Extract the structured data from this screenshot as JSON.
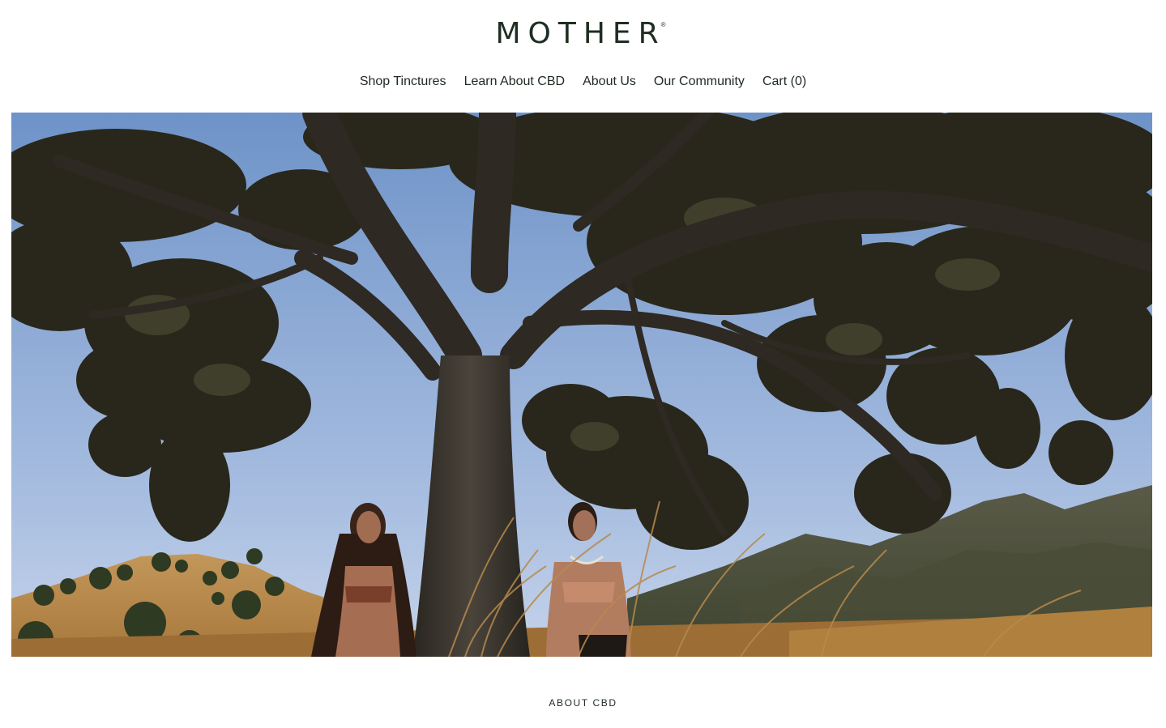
{
  "header": {
    "logo_text": "MOTHER",
    "logo_mark": "®"
  },
  "nav": {
    "items": [
      {
        "label": "Shop Tinctures"
      },
      {
        "label": "Learn About CBD"
      },
      {
        "label": "About Us"
      },
      {
        "label": "Our Community"
      },
      {
        "label": "Cart (0)"
      }
    ]
  },
  "hero": {
    "image": "photo of two women walking in dry grass beneath a large oak tree with hills behind"
  },
  "section": {
    "label": "ABOUT CBD"
  },
  "colors": {
    "brand_text": "#1e2e22",
    "sky_top": "#6f94c9",
    "sky_bottom": "#bccce6",
    "foliage": "#2c2a1d",
    "grass": "#a8763a"
  }
}
